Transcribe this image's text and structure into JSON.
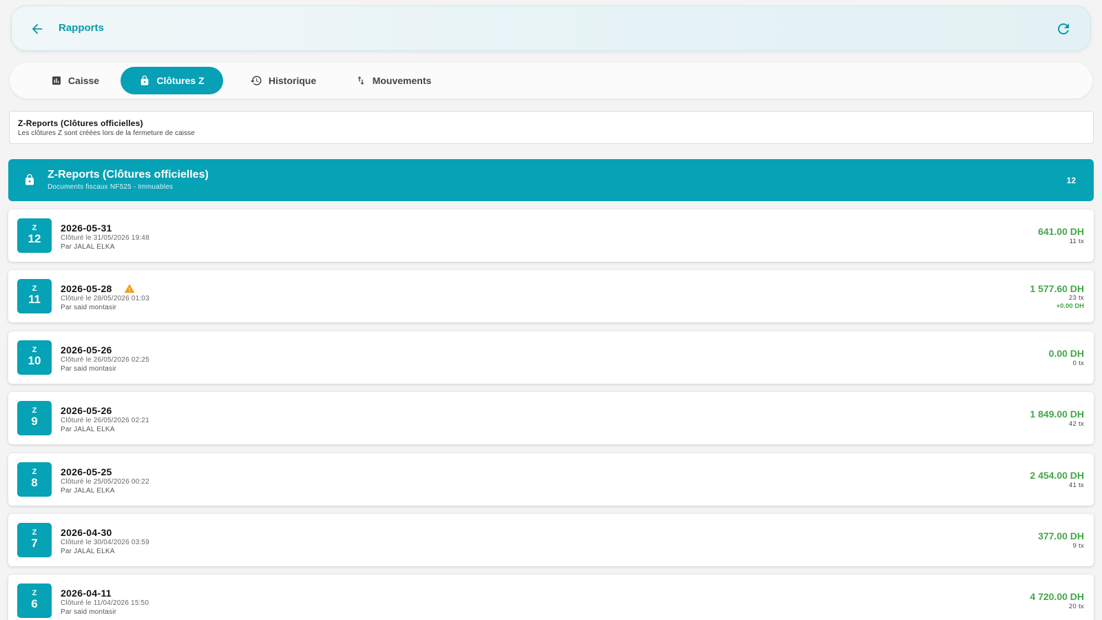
{
  "header": {
    "title": "Rapports",
    "back_icon": "arrow-left-icon",
    "refresh_icon": "refresh-icon",
    "accent_color": "#0a9aae"
  },
  "tabs": [
    {
      "label": "Caisse",
      "icon": "bar-chart-icon",
      "active": false
    },
    {
      "label": "Clôtures Z",
      "icon": "lock-icon",
      "active": true
    },
    {
      "label": "Historique",
      "icon": "history-icon",
      "active": false
    },
    {
      "label": "Mouvements",
      "icon": "swap-vertical-icon",
      "active": false
    }
  ],
  "info": {
    "title": "Z-Reports (Clôtures officielles)",
    "subtitle": "Les clôtures Z sont créées lors de la fermeture de caisse"
  },
  "banner": {
    "title": "Z-Reports (Clôtures officielles)",
    "subtitle": "Documents fiscaux NF525 - Immuables",
    "count": "12",
    "color": "#06a2b6"
  },
  "reports": [
    {
      "z_label": "Z",
      "number": "12",
      "date": "2026-05-31",
      "closed_at": "Clôturé le 31/05/2026 19:48",
      "by": "Par JALAL ELKA",
      "amount": "641.00 DH",
      "tx": "11 tx",
      "warning": false,
      "diff": ""
    },
    {
      "z_label": "Z",
      "number": "11",
      "date": "2026-05-28",
      "closed_at": "Clôturé le 28/05/2026 01:03",
      "by": "Par said montasir",
      "amount": "1 577.60 DH",
      "tx": "23 tx",
      "warning": true,
      "diff": "+0.00 DH"
    },
    {
      "z_label": "Z",
      "number": "10",
      "date": "2026-05-26",
      "closed_at": "Clôturé le 26/05/2026 02:25",
      "by": "Par said montasir",
      "amount": "0.00 DH",
      "tx": "0 tx",
      "warning": false,
      "diff": ""
    },
    {
      "z_label": "Z",
      "number": "9",
      "date": "2026-05-26",
      "closed_at": "Clôturé le 26/05/2026 02:21",
      "by": "Par JALAL ELKA",
      "amount": "1 849.00 DH",
      "tx": "42 tx",
      "warning": false,
      "diff": ""
    },
    {
      "z_label": "Z",
      "number": "8",
      "date": "2026-05-25",
      "closed_at": "Clôturé le 25/05/2026 00:22",
      "by": "Par JALAL ELKA",
      "amount": "2 454.00 DH",
      "tx": "41 tx",
      "warning": false,
      "diff": ""
    },
    {
      "z_label": "Z",
      "number": "7",
      "date": "2026-04-30",
      "closed_at": "Clôturé le 30/04/2026 03:59",
      "by": "Par JALAL ELKA",
      "amount": "377.00 DH",
      "tx": "9 tx",
      "warning": false,
      "diff": ""
    },
    {
      "z_label": "Z",
      "number": "6",
      "date": "2026-04-11",
      "closed_at": "Clôturé le 11/04/2026 15:50",
      "by": "Par said montasir",
      "amount": "4 720.00 DH",
      "tx": "20 tx",
      "warning": false,
      "diff": ""
    }
  ],
  "colors": {
    "amount_positive": "#43a747",
    "warning": "#f29b1d"
  }
}
